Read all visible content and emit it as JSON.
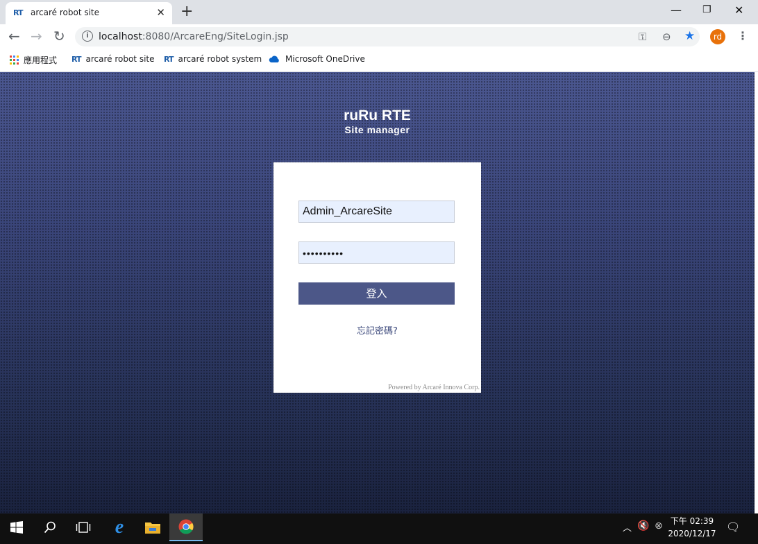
{
  "browser": {
    "tab": {
      "favicon": "RT",
      "title": "arcaré robot site",
      "close": "✕"
    },
    "new_tab": "+",
    "window_controls": {
      "minimize": "—",
      "restore": "❐",
      "close": "✕"
    },
    "address": {
      "host": "localhost",
      "path": ":8080/ArcareEng/SiteLogin.jsp"
    },
    "profile_initials": "rd",
    "bookmarks": [
      {
        "label": "應用程式",
        "icon": "apps-grid-icon"
      },
      {
        "label": "arcaré robot site",
        "icon": "RT"
      },
      {
        "label": "arcaré robot system",
        "icon": "RT"
      },
      {
        "label": "Microsoft OneDrive",
        "icon": "onedrive-icon"
      }
    ]
  },
  "login": {
    "title": "ruRu RTE",
    "subtitle": "Site manager",
    "username": "Admin_ArcareSite",
    "password_mask": "••••••••••",
    "submit_label": "登入",
    "forgot_label": "忘記密碼?",
    "powered_by": "Powered by Arcaré Innova Corp."
  },
  "taskbar": {
    "clock_time": "下午 02:39",
    "clock_date": "2020/12/17"
  },
  "colors": {
    "page_bg": "#34407a",
    "button": "#4c5788",
    "input_bg": "#e8f0fe",
    "avatar": "#e8710a",
    "bookmark_star": "#1a73e8"
  }
}
